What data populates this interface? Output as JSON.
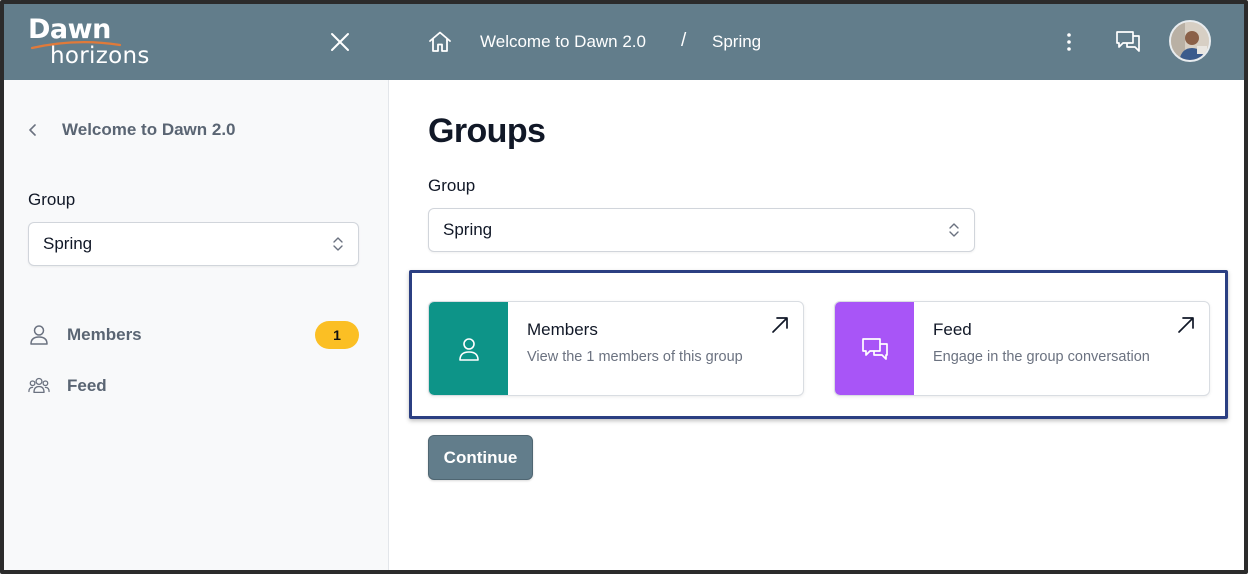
{
  "brand": {
    "logo_top": "Dawn",
    "logo_bottom": "horizons"
  },
  "sidebar": {
    "back_label": "Welcome to Dawn 2.0",
    "group_label": "Group",
    "group_select_value": "Spring",
    "items": [
      {
        "label": "Members",
        "icon": "user-icon",
        "badge": "1"
      },
      {
        "label": "Feed",
        "icon": "people-icon"
      }
    ]
  },
  "topbar": {
    "breadcrumb": [
      "Welcome to Dawn 2.0",
      "Spring"
    ],
    "separator": "/",
    "icons": [
      "home-icon",
      "more-vertical-icon",
      "chat-icon",
      "avatar"
    ]
  },
  "main": {
    "title": "Groups",
    "group_label": "Group",
    "group_select_value": "Spring",
    "cards": [
      {
        "title": "Members",
        "description": "View the 1 members of this group",
        "accent": "#0d9488",
        "icon": "user-icon"
      },
      {
        "title": "Feed",
        "description": "Engage in the group conversation",
        "accent": "#a855f7",
        "icon": "chat-icon"
      }
    ],
    "continue_label": "Continue"
  },
  "colors": {
    "header": "#627d8b",
    "members_accent": "#0d9488",
    "feed_accent": "#a855f7",
    "badge": "#fbbf24",
    "highlight_border": "#2b3f82"
  }
}
